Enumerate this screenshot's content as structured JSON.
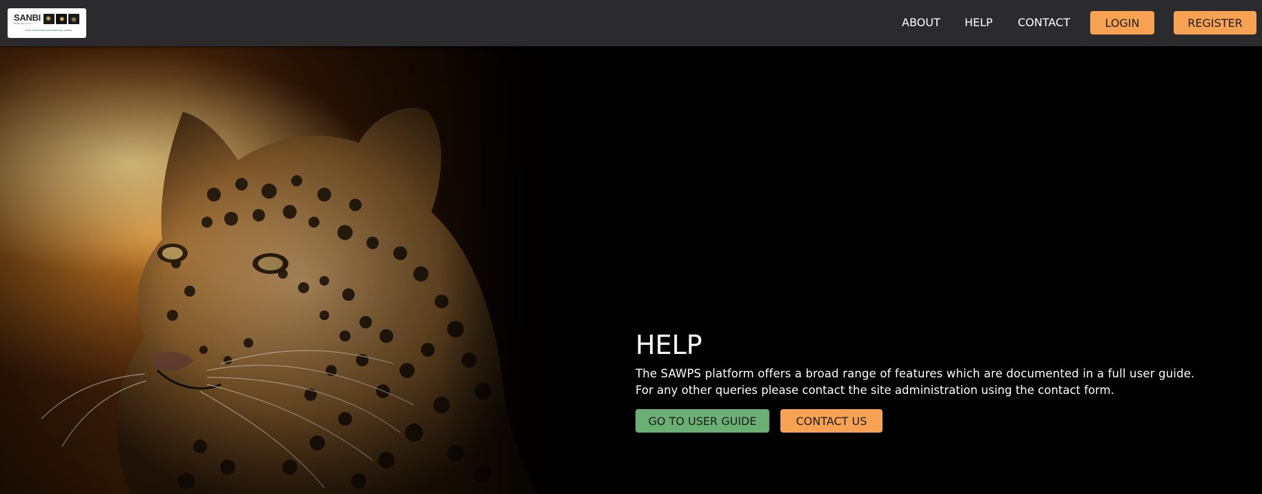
{
  "brand": {
    "logo_title": "SANBI",
    "logo_subtitle": "Biodiversity for Life",
    "logo_caption": "South African National Biodiversity Institute"
  },
  "nav": {
    "links": [
      {
        "label": "ABOUT"
      },
      {
        "label": "HELP"
      },
      {
        "label": "CONTACT"
      }
    ],
    "login_label": "LOGIN",
    "register_label": "REGISTER"
  },
  "hero": {
    "image_subject": "leopard",
    "title": "HELP",
    "body_line1": "The SAWPS platform offers a broad range of features which are documented in a full user guide.",
    "body_line2": "For any other queries please contact the site administration using the contact form.",
    "primary_button": "GO TO USER GUIDE",
    "secondary_button": "CONTACT US"
  },
  "colors": {
    "navbar_bg": "#2b2b2d",
    "accent_orange": "#f7a253",
    "accent_green": "#6aaf73",
    "page_bg": "#000000"
  }
}
